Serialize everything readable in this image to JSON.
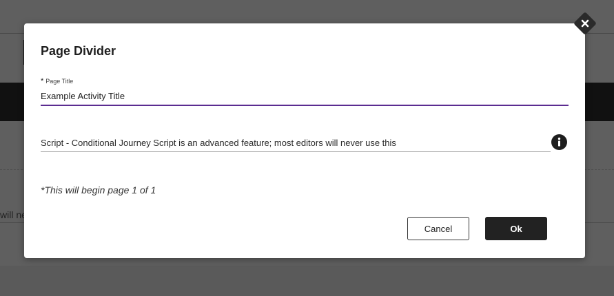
{
  "background": {
    "partial_text": "will ne"
  },
  "dialog": {
    "title": "Page Divider",
    "page_title_field": {
      "required_marker": "*",
      "label": "Page Title",
      "value": "Example Activity Title"
    },
    "script_field": {
      "value": "Script - Conditional Journey Script is an advanced feature; most editors will never use this"
    },
    "page_note": "*This will begin page 1 of 1",
    "cancel_label": "Cancel",
    "ok_label": "Ok",
    "accent_color": "#5b2c91"
  }
}
